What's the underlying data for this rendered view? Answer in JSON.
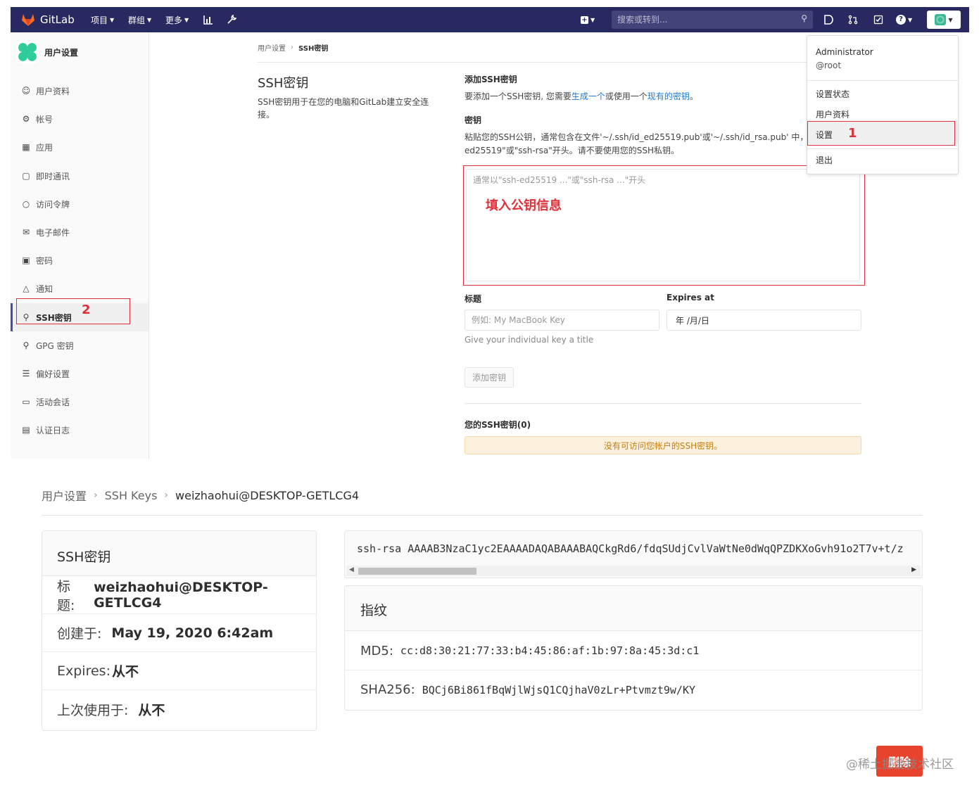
{
  "top": {
    "navbar": {
      "brand": "GitLab",
      "projects": "项目",
      "groups": "群组",
      "more": "更多",
      "search_placeholder": "搜索或转到..."
    },
    "sidebar": {
      "title": "用户设置",
      "items": [
        {
          "label": "用户资料",
          "icon": "profile-icon"
        },
        {
          "label": "帐号",
          "icon": "account-icon"
        },
        {
          "label": "应用",
          "icon": "applications-icon"
        },
        {
          "label": "即时通讯",
          "icon": "chat-icon"
        },
        {
          "label": "访问令牌",
          "icon": "token-icon"
        },
        {
          "label": "电子邮件",
          "icon": "mail-icon"
        },
        {
          "label": "密码",
          "icon": "lock-icon"
        },
        {
          "label": "通知",
          "icon": "bell-icon"
        },
        {
          "label": "SSH密钥",
          "icon": "key-icon"
        },
        {
          "label": "GPG 密钥",
          "icon": "key-icon"
        },
        {
          "label": "偏好设置",
          "icon": "preferences-icon"
        },
        {
          "label": "活动会话",
          "icon": "monitor-icon"
        },
        {
          "label": "认证日志",
          "icon": "log-icon"
        }
      ],
      "active_index": 8,
      "annotation": "2"
    },
    "breadcrumb": [
      "用户设置",
      "SSH密钥"
    ],
    "page": {
      "title": "SSH密钥",
      "description": "SSH密钥用于在您的电脑和GitLab建立安全连接。",
      "add_title": "添加SSH密钥",
      "add_desc_prefix": "要添加一个SSH密钥, 您需要",
      "add_desc_link1": "生成一个",
      "add_desc_mid": "或使用一个",
      "add_desc_link2": "现有的密钥",
      "add_desc_suffix": "。",
      "key_label": "密钥",
      "key_desc_line1": "粘贴您的SSH公钥，通常包含在文件'~/.ssh/id_ed25519.pub'或'~/.ssh/id_rsa.pub' 中，并",
      "key_desc_line2": "ed25519\"或\"ssh-rsa\"开头。请不要使用您的SSH私钥。",
      "key_placeholder": "通常以\"ssh-ed25519 ...\"或\"ssh-rsa ...\"开头",
      "key_annotation": "填入公钥信息",
      "title_label": "标题",
      "title_placeholder": "例如: My MacBook Key",
      "expires_label": "Expires at",
      "expires_value": "年 /月/日",
      "title_help": "Give your individual key a title",
      "add_button": "添加密钥",
      "your_keys_title": "您的SSH密钥(0)",
      "no_keys_alert": "没有可访问您帐户的SSH密钥。"
    },
    "dropdown": {
      "name": "Administrator",
      "username": "@root",
      "items": [
        "设置状态",
        "用户资料",
        "设置",
        "退出"
      ],
      "annotation": "1"
    }
  },
  "bottom": {
    "breadcrumb": [
      "用户设置",
      "SSH Keys",
      "weizhaohui@DESKTOP-GETLCG4"
    ],
    "key_card": {
      "header": "SSH密钥",
      "title_label": "标题:",
      "title_value": "weizhaohui@DESKTOP-GETLCG4",
      "created_label": "创建于:",
      "created_value": "May 19, 2020 6:42am",
      "expires_label": "Expires:",
      "expires_value": "从不",
      "last_used_label": "上次使用于:",
      "last_used_value": "从不"
    },
    "public_key": "ssh-rsa AAAAB3NzaC1yc2EAAAADAQABAAABAQCkgRd6/fdqSUdjCvlVaWtNe0dWqQPZDKXoGvh91o2T7v+t/z",
    "fingerprints": {
      "header": "指纹",
      "md5_label": "MD5:",
      "md5_value": "cc:d8:30:21:77:33:b4:45:86:af:1b:97:8a:45:3d:c1",
      "sha256_label": "SHA256:",
      "sha256_value": "BQCj6Bi861fBqWjlWjsQ1CQjhaV0zLr+Ptvmzt9w/KY"
    },
    "delete_button": "删除",
    "watermark": "@稀土掘金技术社区"
  },
  "colors": {
    "navbar": "#292961",
    "annotation_red": "#e0303a",
    "delete_red": "#e8442d",
    "link": "#1f78d1"
  }
}
